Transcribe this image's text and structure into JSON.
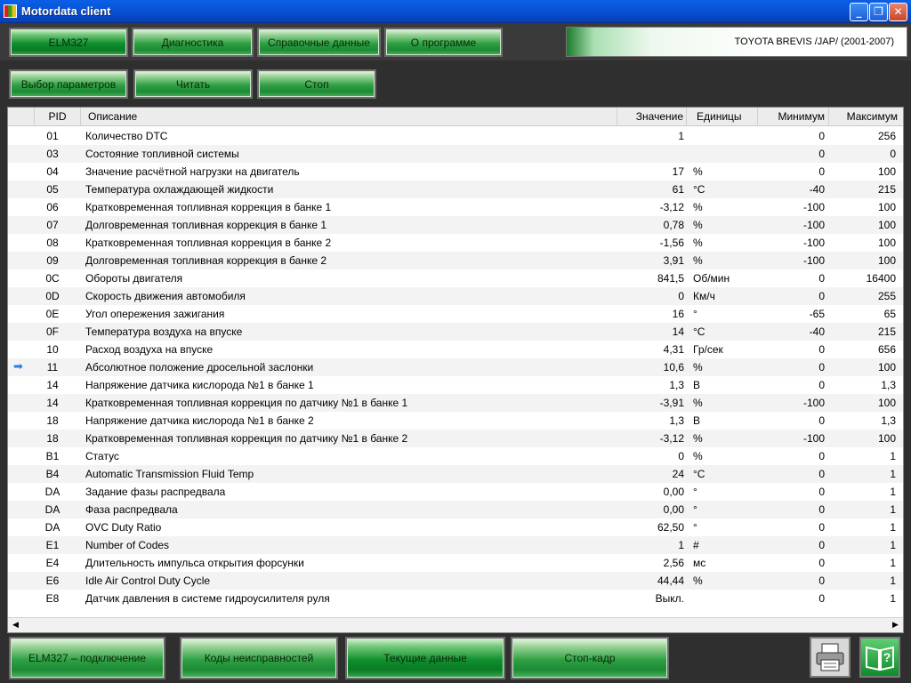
{
  "window": {
    "title": "Motordata client"
  },
  "menu": {
    "elm": "ELM327",
    "diag": "Диагностика",
    "ref": "Справочные данные",
    "about": "О программе"
  },
  "vehicle": "TOYOTA  BREVIS /JAP/  (2001-2007)",
  "toolbar": {
    "select_params": "Выбор параметров",
    "read": "Читать",
    "stop": "Стоп"
  },
  "table": {
    "columns": {
      "pid": "PID",
      "desc": "Описание",
      "value": "Значение",
      "units": "Единицы",
      "min": "Минимум",
      "max": "Максимум"
    },
    "rows": [
      {
        "pid": "01",
        "desc": "Количество DTC",
        "value": "1",
        "unit": "",
        "min": "0",
        "max": "256"
      },
      {
        "pid": "03",
        "desc": "Состояние топливной системы",
        "value": "",
        "unit": "",
        "min": "0",
        "max": "0"
      },
      {
        "pid": "04",
        "desc": "Значение расчётной нагрузки на двигатель",
        "value": "17",
        "unit": "%",
        "min": "0",
        "max": "100"
      },
      {
        "pid": "05",
        "desc": "Температура охлаждающей жидкости",
        "value": "61",
        "unit": "°C",
        "min": "-40",
        "max": "215"
      },
      {
        "pid": "06",
        "desc": "Кратковременная топливная коррекция в банке 1",
        "value": "-3,12",
        "unit": "%",
        "min": "-100",
        "max": "100"
      },
      {
        "pid": "07",
        "desc": "Долговременная топливная коррекция в банке 1",
        "value": "0,78",
        "unit": "%",
        "min": "-100",
        "max": "100"
      },
      {
        "pid": "08",
        "desc": "Кратковременная топливная коррекция в банке 2",
        "value": "-1,56",
        "unit": "%",
        "min": "-100",
        "max": "100"
      },
      {
        "pid": "09",
        "desc": "Долговременная топливная коррекция в банке 2",
        "value": "3,91",
        "unit": "%",
        "min": "-100",
        "max": "100"
      },
      {
        "pid": "0C",
        "desc": "Обороты двигателя",
        "value": "841,5",
        "unit": "Об/мин",
        "min": "0",
        "max": "16400"
      },
      {
        "pid": "0D",
        "desc": "Скорость движения автомобиля",
        "value": "0",
        "unit": "Км/ч",
        "min": "0",
        "max": "255"
      },
      {
        "pid": "0E",
        "desc": "Угол опережения зажигания",
        "value": "16",
        "unit": "°",
        "min": "-65",
        "max": "65"
      },
      {
        "pid": "0F",
        "desc": "Температура воздуха на впуске",
        "value": "14",
        "unit": "°C",
        "min": "-40",
        "max": "215"
      },
      {
        "pid": "10",
        "desc": "Расход воздуха на впуске",
        "value": "4,31",
        "unit": "Гр/сек",
        "min": "0",
        "max": "656"
      },
      {
        "pid": "11",
        "desc": "Абсолютное положение дросельной заслонки",
        "value": "10,6",
        "unit": "%",
        "min": "0",
        "max": "100",
        "current": true
      },
      {
        "pid": "14",
        "desc": "Напряжение датчика кислорода №1 в банке 1",
        "value": "1,3",
        "unit": "В",
        "min": "0",
        "max": "1,3"
      },
      {
        "pid": "14",
        "desc": "Кратковременная топливная коррекция по датчику №1 в банке 1",
        "value": "-3,91",
        "unit": "%",
        "min": "-100",
        "max": "100"
      },
      {
        "pid": "18",
        "desc": "Напряжение датчика кислорода №1 в банке 2",
        "value": "1,3",
        "unit": "В",
        "min": "0",
        "max": "1,3"
      },
      {
        "pid": "18",
        "desc": "Кратковременная топливная коррекция по датчику №1 в банке 2",
        "value": "-3,12",
        "unit": "%",
        "min": "-100",
        "max": "100"
      },
      {
        "pid": "B1",
        "desc": "Статус",
        "value": "0",
        "unit": "%",
        "min": "0",
        "max": "1"
      },
      {
        "pid": "B4",
        "desc": "Automatic Transmission Fluid Temp",
        "value": "24",
        "unit": "°C",
        "min": "0",
        "max": "1"
      },
      {
        "pid": "DA",
        "desc": "Задание фазы распредвала",
        "value": "0,00",
        "unit": "°",
        "min": "0",
        "max": "1"
      },
      {
        "pid": "DA",
        "desc": "Фаза распредвала",
        "value": "0,00",
        "unit": "°",
        "min": "0",
        "max": "1"
      },
      {
        "pid": "DA",
        "desc": "OVC Duty Ratio",
        "value": "62,50",
        "unit": "°",
        "min": "0",
        "max": "1"
      },
      {
        "pid": "E1",
        "desc": "Number of Codes",
        "value": "1",
        "unit": "#",
        "min": "0",
        "max": "1"
      },
      {
        "pid": "E4",
        "desc": "Длительность импульса открытия форсунки",
        "value": "2,56",
        "unit": "мс",
        "min": "0",
        "max": "1"
      },
      {
        "pid": "E6",
        "desc": "Idle Air Control Duty Cycle",
        "value": "44,44",
        "unit": "%",
        "min": "0",
        "max": "1"
      },
      {
        "pid": "E8",
        "desc": "Датчик давления в системе гидроусилителя руля",
        "value": "Выкл.",
        "unit": "",
        "min": "0",
        "max": "1"
      }
    ]
  },
  "bottom": {
    "connect": "ELM327 – подключение",
    "codes": "Коды неисправностей",
    "current": "Текущие данные",
    "freeze": "Стоп-кадр"
  },
  "icons": {
    "print": "printer-icon",
    "help": "help-book-icon",
    "current_row": "arrow-right-icon"
  }
}
